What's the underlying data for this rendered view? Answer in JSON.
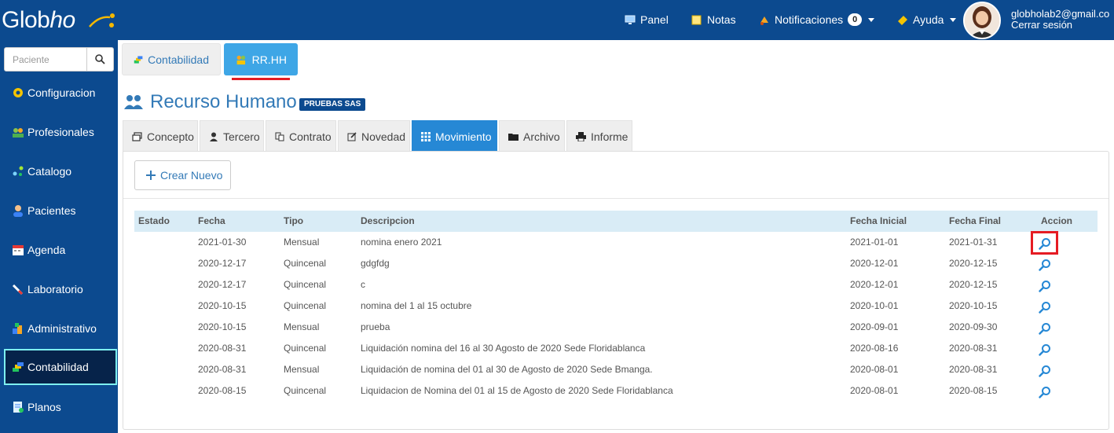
{
  "brand": {
    "name_a": "Glob",
    "name_b": "ho"
  },
  "topnav": {
    "panel": "Panel",
    "notas": "Notas",
    "notificaciones": "Notificaciones",
    "notif_count": "0",
    "ayuda": "Ayuda",
    "user_email": "globholab2@gmail.co",
    "logout": "Cerrar sesión"
  },
  "sidebar": {
    "search_placeholder": "Paciente",
    "items": [
      {
        "label": "Configuracion",
        "icon": "gear-icon"
      },
      {
        "label": "Profesionales",
        "icon": "professionals-icon"
      },
      {
        "label": "Catalogo",
        "icon": "catalog-icon"
      },
      {
        "label": "Pacientes",
        "icon": "patient-icon"
      },
      {
        "label": "Agenda",
        "icon": "calendar-icon"
      },
      {
        "label": "Laboratorio",
        "icon": "lab-icon"
      },
      {
        "label": "Administrativo",
        "icon": "admin-icon"
      },
      {
        "label": "Contabilidad",
        "icon": "accounting-icon",
        "active": true
      },
      {
        "label": "Planos",
        "icon": "document-icon"
      }
    ]
  },
  "module_tabs": [
    {
      "label": "Contabilidad",
      "active": false
    },
    {
      "label": "RR.HH",
      "active": true
    }
  ],
  "page": {
    "title": "Recurso Humano",
    "org_badge": "PRUEBAS SAS"
  },
  "sub_tabs": [
    {
      "label": "Concepto",
      "icon": "window-icon"
    },
    {
      "label": "Tercero",
      "icon": "user-icon"
    },
    {
      "label": "Contrato",
      "icon": "copy-icon"
    },
    {
      "label": "Novedad",
      "icon": "edit-icon"
    },
    {
      "label": "Movimiento",
      "icon": "grid-icon",
      "active": true
    },
    {
      "label": "Archivo",
      "icon": "folder-icon"
    },
    {
      "label": "Informe",
      "icon": "print-icon"
    }
  ],
  "create_button": "Crear Nuevo",
  "table": {
    "headers": [
      "Estado",
      "Fecha",
      "Tipo",
      "Descripcion",
      "Fecha Inicial",
      "Fecha Final",
      "Accion"
    ],
    "rows": [
      {
        "estado": "",
        "fecha": "2021-01-30",
        "tipo": "Mensual",
        "descripcion": "nomina enero 2021",
        "fecha_inicial": "2021-01-01",
        "fecha_final": "2021-01-31"
      },
      {
        "estado": "",
        "fecha": "2020-12-17",
        "tipo": "Quincenal",
        "descripcion": "gdgfdg",
        "fecha_inicial": "2020-12-01",
        "fecha_final": "2020-12-15"
      },
      {
        "estado": "",
        "fecha": "2020-12-17",
        "tipo": "Quincenal",
        "descripcion": "c",
        "fecha_inicial": "2020-12-01",
        "fecha_final": "2020-12-15"
      },
      {
        "estado": "",
        "fecha": "2020-10-15",
        "tipo": "Quincenal",
        "descripcion": "nomina del 1 al 15 octubre",
        "fecha_inicial": "2020-10-01",
        "fecha_final": "2020-10-15"
      },
      {
        "estado": "",
        "fecha": "2020-10-15",
        "tipo": "Mensual",
        "descripcion": "prueba",
        "fecha_inicial": "2020-09-01",
        "fecha_final": "2020-09-30"
      },
      {
        "estado": "",
        "fecha": "2020-08-31",
        "tipo": "Quincenal",
        "descripcion": "Liquidación nomina del 16 al 30 Agosto de 2020 Sede Floridablanca",
        "fecha_inicial": "2020-08-16",
        "fecha_final": "2020-08-31"
      },
      {
        "estado": "",
        "fecha": "2020-08-31",
        "tipo": "Mensual",
        "descripcion": "Liquidación de nomina del 01 al 30 de Agosto de 2020 Sede Bmanga.",
        "fecha_inicial": "2020-08-01",
        "fecha_final": "2020-08-31"
      },
      {
        "estado": "",
        "fecha": "2020-08-15",
        "tipo": "Quincenal",
        "descripcion": "Liquidacion de Nomina del 01 al 15 de Agosto de 2020 Sede Floridablanca",
        "fecha_inicial": "2020-08-01",
        "fecha_final": "2020-08-15"
      }
    ]
  },
  "colors": {
    "brand_blue": "#0c4a8f",
    "link_blue": "#337ab7",
    "active_tab": "#2688d5",
    "highlight_red": "#e51c23"
  }
}
